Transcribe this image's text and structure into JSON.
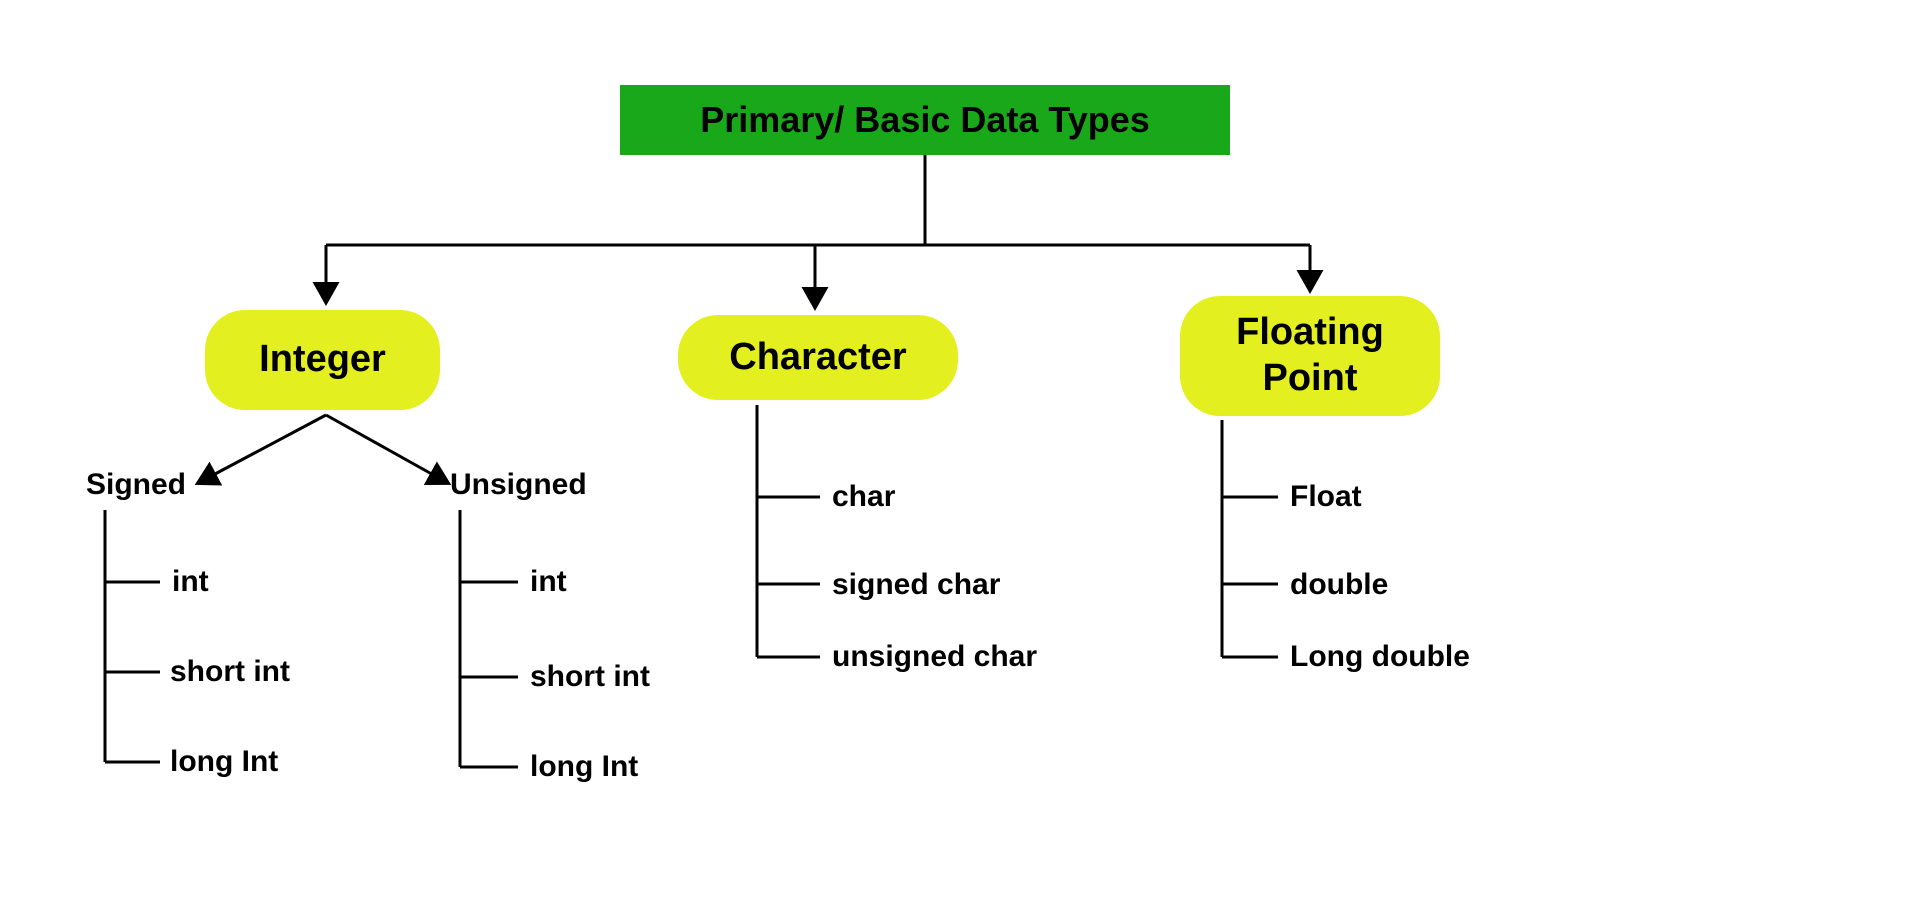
{
  "root": {
    "title": "Primary/ Basic Data Types"
  },
  "categories": {
    "integer": {
      "label": "Integer",
      "sub": {
        "signed": {
          "label": "Signed",
          "items": [
            "int",
            "short int",
            "long Int"
          ]
        },
        "unsigned": {
          "label": "Unsigned",
          "items": [
            "int",
            "short int",
            "long Int"
          ]
        }
      }
    },
    "character": {
      "label": "Character",
      "items": [
        "char",
        "signed char",
        "unsigned char"
      ]
    },
    "floating": {
      "label": "Floating Point",
      "items": [
        "Float",
        "double",
        "Long double"
      ]
    }
  },
  "colors": {
    "root_bg": "#19a819",
    "category_bg": "#e4ef1f",
    "text": "#000000"
  }
}
